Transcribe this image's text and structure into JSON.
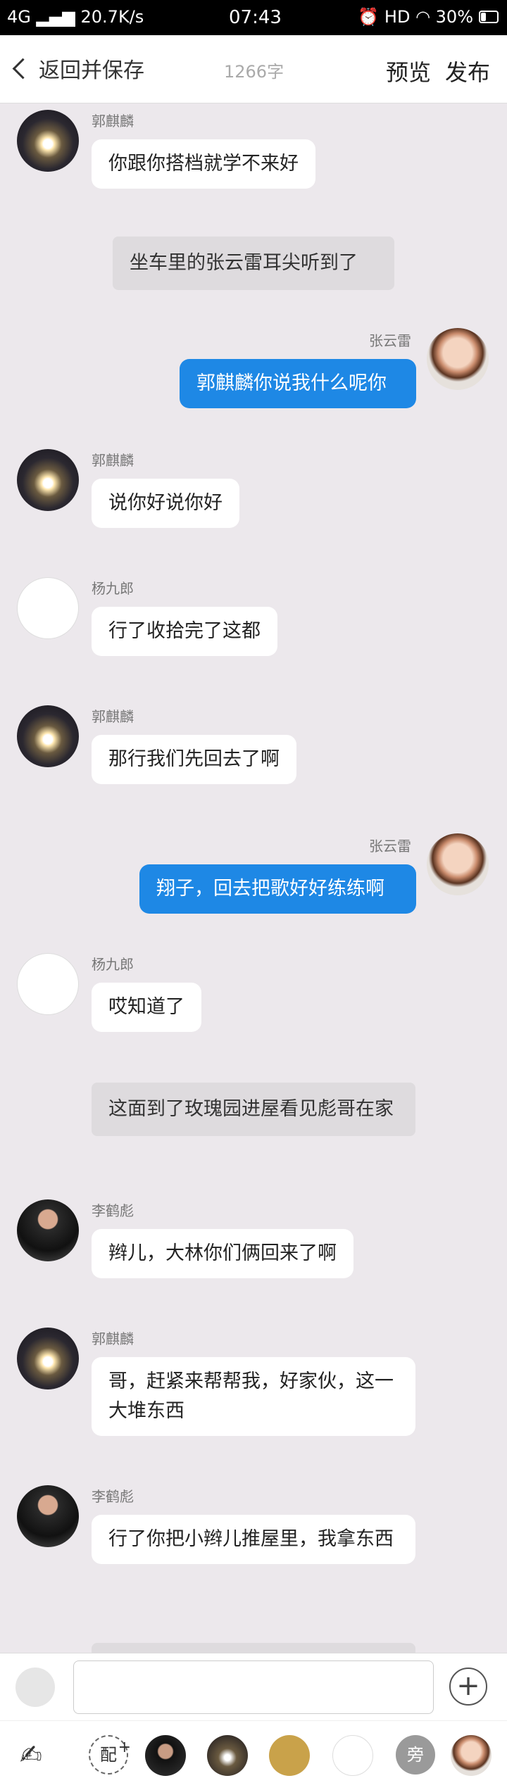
{
  "status": {
    "network": "4G",
    "speed": "20.7K/s",
    "time": "07:43",
    "hd": "HD",
    "battery": "30%"
  },
  "header": {
    "back": "返回并保存",
    "count": "1266字",
    "preview": "预览",
    "publish": "发布"
  },
  "messages": [
    {
      "name": "郭麒麟",
      "text": "你跟你搭档就学不来好"
    },
    {
      "narration": "坐车里的张云雷耳尖听到了"
    },
    {
      "name": "张云雷",
      "text": "郭麒麟你说我什么呢你"
    },
    {
      "name": "郭麒麟",
      "text": "说你好说你好"
    },
    {
      "name": "杨九郎",
      "text": "行了收拾完了这都"
    },
    {
      "name": "郭麒麟",
      "text": "那行我们先回去了啊"
    },
    {
      "name": "张云雷",
      "text": "翔子，回去把歌好好练练啊"
    },
    {
      "name": "杨九郎",
      "text": "哎知道了"
    },
    {
      "narration": "这面到了玫瑰园进屋看见彪哥在家"
    },
    {
      "name": "李鹤彪",
      "text": "辫儿，大林你们俩回来了啊"
    },
    {
      "name": "郭麒麟",
      "text": "哥，赶紧来帮帮我，好家伙，这一大堆东西"
    },
    {
      "name": "李鹤彪",
      "text": "行了你把小辫儿推屋里，我拿东西"
    }
  ],
  "castbar": {
    "pei": "配",
    "pang": "旁"
  },
  "icons": [
    "back-icon",
    "avatar-icon",
    "plus-icon",
    "write-icon"
  ]
}
